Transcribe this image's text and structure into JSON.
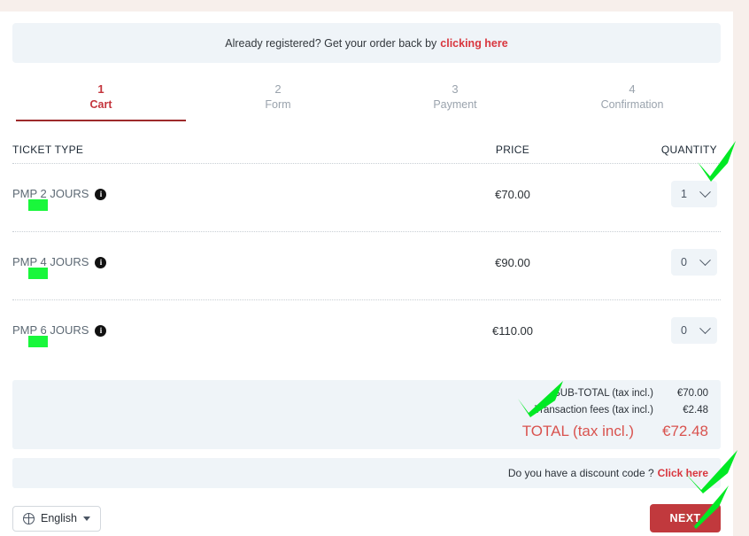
{
  "notice": {
    "text": "Already registered? Get your order back by",
    "link_label": "clicking here"
  },
  "steps": [
    {
      "num": "1",
      "label": "Cart"
    },
    {
      "num": "2",
      "label": "Form"
    },
    {
      "num": "3",
      "label": "Payment"
    },
    {
      "num": "4",
      "label": "Confirmation"
    }
  ],
  "table": {
    "headers": {
      "type": "TICKET TYPE",
      "price": "PRICE",
      "quantity": "QUANTITY"
    },
    "rows": [
      {
        "name": "PMP 2 JOURS",
        "info_icon": "info-icon",
        "price": "€70.00",
        "quantity": "1"
      },
      {
        "name": "PMP 4 JOURS",
        "info_icon": "info-icon",
        "price": "€90.00",
        "quantity": "0"
      },
      {
        "name": "PMP 6 JOURS",
        "info_icon": "info-icon",
        "price": "€110.00",
        "quantity": "0"
      }
    ]
  },
  "totals": {
    "subtotal_label": "SUB-TOTAL (tax incl.)",
    "subtotal_value": "€70.00",
    "fees_label": "Transaction fees (tax incl.)",
    "fees_value": "€2.48",
    "total_label": "TOTAL (tax incl.)",
    "total_value": "€72.48"
  },
  "discount": {
    "text": "Do you have a discount code ?",
    "link_label": "Click here"
  },
  "footer": {
    "language_label": "English",
    "language_icon": "globe-icon",
    "next_label": "NEXT"
  },
  "colors": {
    "accent_red": "#c1393d",
    "link_red": "#d9363e",
    "total_red": "#d9534f",
    "panel_blue": "#eff4f8",
    "highlight_green": "#19f73b",
    "band_cream": "#f7efeb"
  }
}
